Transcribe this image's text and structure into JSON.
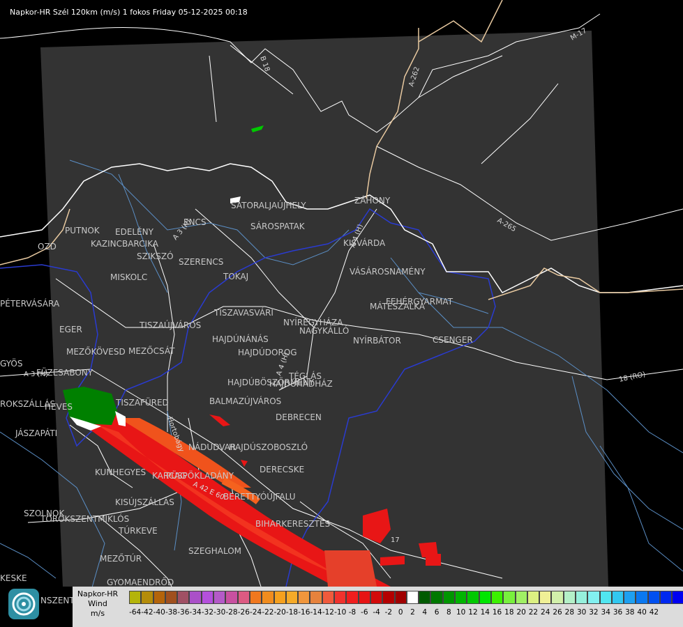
{
  "title": "Napkor-HR Szél 120km (m/s) 1 fokos Friday 05-12-2025 00:18",
  "cities": [
    "SÁTORALJAÚJHELY",
    "ZÁHONY",
    "SÁROSPATAK",
    "KISVÁRDA",
    "PUTNOK",
    "EDELÉNY",
    "KAZINCBARCIKA",
    "ENCS",
    "SZIKSZÓ",
    "SZERENCS",
    "MISKOLC",
    "TOKAJ",
    "VÁSÁROSNAMÉNY",
    "FEHÉRGYARMAT",
    "MÁTÉSZALKA",
    "PÉTERVÁSÁRA",
    "TISZAVASVÁRI",
    "NYÍREGYHÁZA",
    "NAGYKÁLLÓ",
    "EGER",
    "TISZAÚJVÁROS",
    "HAJDÚNÁNÁS",
    "NYÍRBÁTOR",
    "CSENGER",
    "HAJDÚDOROG",
    "MEZŐKÖVESD",
    "MEZŐCSÁT",
    "GYÖS",
    "FÜZESABONY",
    "TÉGLÁS",
    "HAJDÚBÖSZÖRMÉNY",
    "HAJDÚHADHÁZ",
    "BALMAZÚJVÁROS",
    "HEVES",
    "TISZAFÜRED",
    "ROKSZÁLLÁS",
    "JÁSZAPÁTI",
    "DEBRECEN",
    "NÁDUDVAR",
    "HAJDÚSZOBOSZLÓ",
    "KUNHEGYES",
    "DERECSKE",
    "KARCAG",
    "PÜSPÖKLADÁNY",
    "BERETTYÓÚJFALU",
    "KISÚJSZÁLLÁS",
    "SZOLNOK",
    "TÖRÖKSZENTMIKLÓS",
    "BIHARKERESZTES",
    "TÚRKEVE",
    "SZEGHALOM",
    "MEZŐTÚR",
    "KESKE",
    "GYOMAENDRŐD",
    "NSZENTMÁRT",
    "OZD"
  ],
  "roads": [
    "B 18",
    "A-262",
    "M-17",
    "A-265",
    "A 3 (H)",
    "A 4 (H)",
    "A 4 (H)",
    "A 3 (H)",
    "18 (RO)",
    "A 42 E 60",
    "Hortobágy",
    "17"
  ],
  "legend": {
    "title_line1": "Napkor-HR",
    "title_line2": "Wind",
    "title_line3": "m/s",
    "colors": [
      "#b4b40a",
      "#b48c0a",
      "#b4640a",
      "#a0501e",
      "#a05064",
      "#aa50c8",
      "#b450dc",
      "#b45ac8",
      "#c850a0",
      "#dc5a82",
      "#f0781e",
      "#f08c1e",
      "#f5a01e",
      "#f5aa28",
      "#f0963c",
      "#e6823c",
      "#f05a3c",
      "#f0322d",
      "#f01e1e",
      "#e61414",
      "#d20a0a",
      "#b40000",
      "#a00000",
      "#ffffff",
      "#005a00",
      "#007800",
      "#009600",
      "#00b400",
      "#00c800",
      "#00e600",
      "#3cf000",
      "#78f03c",
      "#a0f064",
      "#dcf082",
      "#f0f096",
      "#d2f0aa",
      "#b4f0c8",
      "#96f0dc",
      "#82f0f0",
      "#50e6f0",
      "#32c8f0",
      "#1ea0f0",
      "#0a78f0",
      "#0050f0",
      "#0028f0",
      "#0000f0"
    ],
    "ticks": [
      "-64",
      "-42",
      "-40",
      "-38",
      "-36",
      "-34",
      "-32",
      "-30",
      "-28",
      "-26",
      "-24",
      "-22",
      "-20",
      "-18",
      "-16",
      "-14",
      "-12",
      "-10",
      "-8",
      "-6",
      "-4",
      "-2",
      "0",
      "2",
      "4",
      "6",
      "8",
      "10",
      "12",
      "14",
      "16",
      "18",
      "20",
      "22",
      "24",
      "26",
      "28",
      "30",
      "32",
      "34",
      "36",
      "38",
      "40",
      "42"
    ]
  }
}
